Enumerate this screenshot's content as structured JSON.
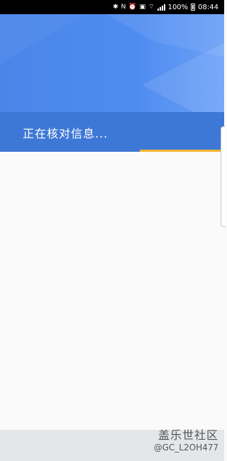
{
  "status_bar": {
    "battery_percent_label": "100%",
    "time": "08:44",
    "icons": [
      "bluetooth-icon",
      "nfc-icon",
      "alarm-icon",
      "vibrate-icon",
      "wifi-icon",
      "signal-icon",
      "battery-icon"
    ]
  },
  "header": {
    "status_text": "正在核对信息...",
    "progress": 0.62,
    "colors": {
      "primary": "#4a86e8",
      "banner": "#3e78d6",
      "progress": "#f5b430"
    }
  },
  "watermark": {
    "title": "盖乐世社区",
    "user": "@GC_L2OH477"
  }
}
